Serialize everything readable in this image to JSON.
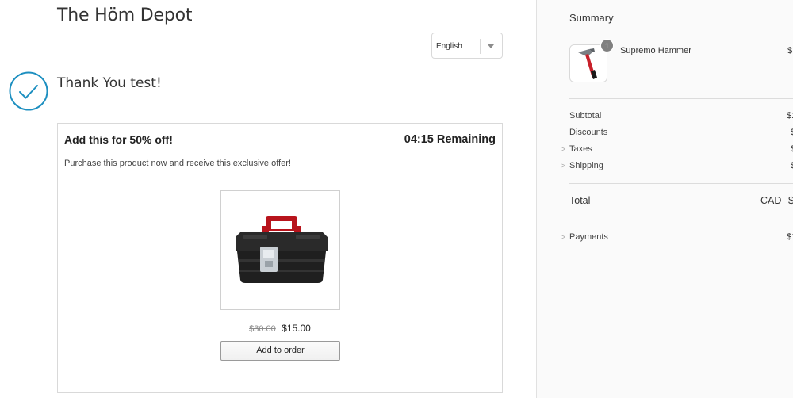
{
  "header": {
    "store_name": "The Höm Depot",
    "language": "English"
  },
  "confirmation": {
    "message": "Thank You test!"
  },
  "offer": {
    "title": "Add this for 50% off!",
    "timer": "04:15 Remaining",
    "description": "Purchase this product now and receive this exclusive offer!",
    "original_price": "$30.00",
    "sale_price": "$15.00",
    "button_label": "Add to order",
    "product_image_icon": "toolbox-icon"
  },
  "summary": {
    "title": "Summary",
    "line_items": [
      {
        "name": "Supremo Hammer",
        "quantity": "1",
        "price": "$",
        "icon": "hammer-icon"
      }
    ],
    "rows": [
      {
        "label": "Subtotal",
        "value": "$1",
        "expandable": false
      },
      {
        "label": "Discounts",
        "value": "$",
        "expandable": false
      },
      {
        "label": "Taxes",
        "value": "$",
        "expandable": true
      },
      {
        "label": "Shipping",
        "value": "$",
        "expandable": true
      }
    ],
    "total_label": "Total",
    "total_currency": "CAD",
    "total_value": "$",
    "payments_label": "Payments",
    "payments_value": "$1"
  },
  "colors": {
    "accent": "#1d8fc0",
    "hammer_red": "#c8202a",
    "toolbox_red": "#b8141c",
    "toolbox_body": "#232323"
  }
}
